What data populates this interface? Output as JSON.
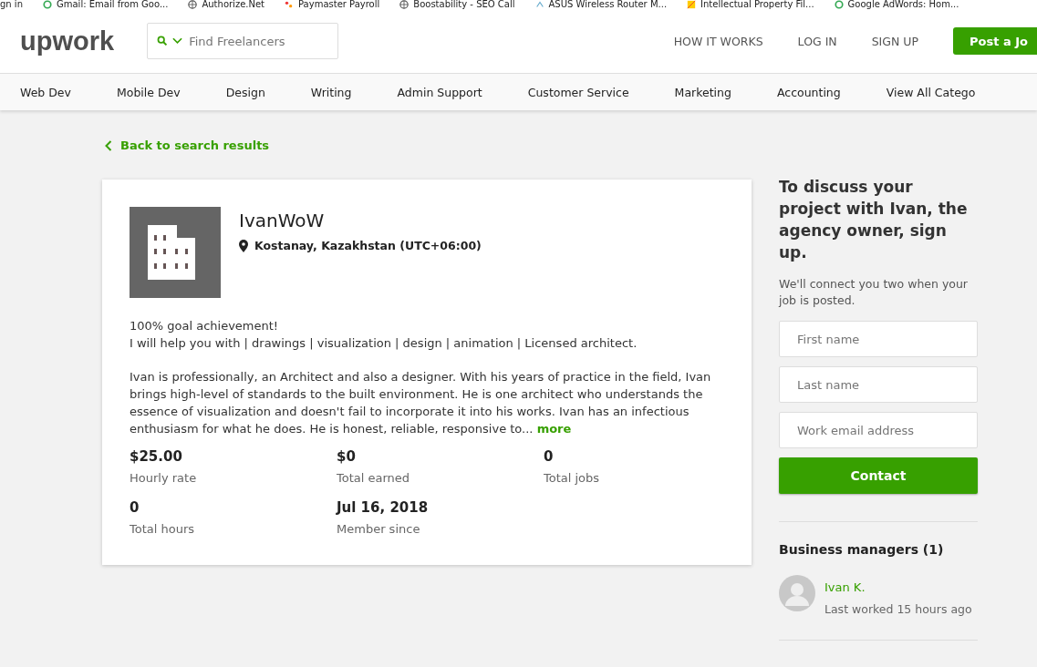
{
  "bookmarks": [
    {
      "label": "gn in",
      "kind": "plain"
    },
    {
      "label": "Gmail: Email from Goo...",
      "kind": "ring"
    },
    {
      "label": "Authorize.Net",
      "kind": "globe"
    },
    {
      "label": "Paymaster Payroll",
      "kind": "dots"
    },
    {
      "label": "Boostability - SEO Call",
      "kind": "globe"
    },
    {
      "label": "ASUS Wireless Router M...",
      "kind": "signal"
    },
    {
      "label": "Intellectual Property Fil...",
      "kind": "flag"
    },
    {
      "label": "Google AdWords: Hom...",
      "kind": "ring"
    }
  ],
  "header": {
    "logo": "upwork",
    "search": {
      "placeholder": "Find Freelancers"
    },
    "links": [
      "HOW IT WORKS",
      "LOG IN",
      "SIGN UP"
    ],
    "post_button": "Post a Jo"
  },
  "categories": [
    "Web Dev",
    "Mobile Dev",
    "Design",
    "Writing",
    "Admin Support",
    "Customer Service",
    "Marketing",
    "Accounting",
    "View All Catego"
  ],
  "back_link": "Back to search results",
  "profile": {
    "name": "IvanWoW",
    "location": "Kostanay, Kazakhstan (UTC+06:00)",
    "headline": [
      "100% goal achievement!",
      "I will help you with | drawings | visualization | design | animation | Licensed architect."
    ],
    "description": "Ivan is professionally, an Architect and also a designer. With his years of practice in the field, Ivan brings high-level of standards to the built environment. He is one architect who understands the essence of visualization and doesn't fail to incorporate it into his works. Ivan has an infectious enthusiasm for what he does. He is honest, reliable, responsive to...",
    "more_link": "more",
    "stats": [
      {
        "value": "$25.00",
        "label": "Hourly rate"
      },
      {
        "value": "$0",
        "label": "Total earned"
      },
      {
        "value": "0",
        "label": "Total jobs"
      },
      {
        "value": "0",
        "label": "Total hours"
      },
      {
        "value": "Jul 16, 2018",
        "label": "Member since"
      }
    ]
  },
  "sidebar": {
    "heading": "To discuss your project with Ivan, the agency owner, sign up.",
    "note": "We'll connect you two when your job is posted.",
    "fields": [
      {
        "placeholder": "First name"
      },
      {
        "placeholder": "Last name"
      },
      {
        "placeholder": "Work email address"
      }
    ],
    "contact_button": "Contact",
    "managers_heading": "Business managers (1)",
    "managers": [
      {
        "name": "Ivan K.",
        "last_worked": "Last worked 15 hours ago"
      }
    ]
  }
}
